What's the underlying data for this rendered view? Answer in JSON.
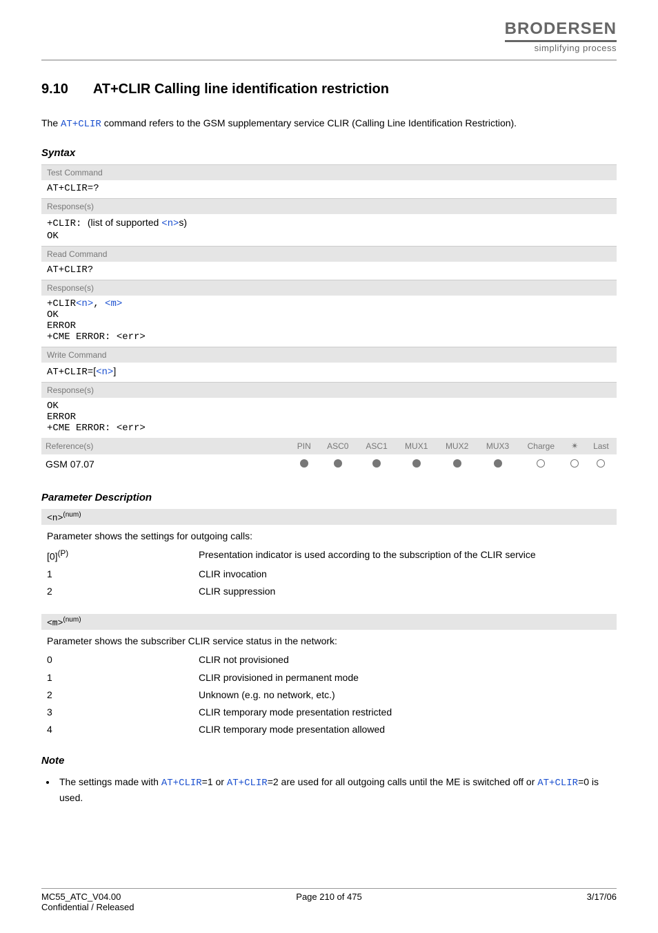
{
  "brand": {
    "name": "BRODERSEN",
    "tagline": "simplifying process"
  },
  "section": {
    "number": "9.10",
    "title": "AT+CLIR   Calling line identification restriction"
  },
  "intro": {
    "pre": "The ",
    "cmd": "AT+CLIR",
    "post": " command refers to the GSM supplementary service CLIR (Calling Line Identification Restriction)."
  },
  "labels": {
    "syntax": "Syntax",
    "test_command": "Test Command",
    "read_command": "Read Command",
    "write_command": "Write Command",
    "responses": "Response(s)",
    "references": "Reference(s)",
    "param_desc": "Parameter Description",
    "note": "Note"
  },
  "syntax": {
    "test_cmd": "AT+CLIR=?",
    "test_resp_prefix": "+CLIR: ",
    "test_resp_text": "(list of supported ",
    "test_resp_param": "<n>",
    "test_resp_suffix": "s)",
    "ok": "OK",
    "read_cmd": "AT+CLIR?",
    "read_resp_prefix": "+CLIR",
    "read_resp_n": "<n>",
    "read_resp_sep": ", ",
    "read_resp_m": "<m>",
    "error": "ERROR",
    "cme_error": "+CME ERROR: <err>",
    "write_cmd_prefix": "AT+CLIR=",
    "write_cmd_open": "[",
    "write_cmd_n": "<n>",
    "write_cmd_close": "]"
  },
  "ref": {
    "headers": [
      "PIN",
      "ASC0",
      "ASC1",
      "MUX1",
      "MUX2",
      "MUX3",
      "Charge",
      "✴",
      "Last"
    ],
    "name": "GSM 07.07",
    "values": [
      "filled",
      "filled",
      "filled",
      "filled",
      "filled",
      "filled",
      "empty",
      "empty",
      "empty"
    ]
  },
  "params": {
    "n": {
      "name": "<n>",
      "type": "(num)",
      "desc": "Parameter shows the settings for outgoing calls:",
      "rows": [
        {
          "key_html": "[0]<sup>(P)</sup>",
          "key": "[0]",
          "sup": "(P)",
          "val": "Presentation indicator is used according to the subscription of the CLIR service"
        },
        {
          "key": "1",
          "val": "CLIR invocation"
        },
        {
          "key": "2",
          "val": "CLIR suppression"
        }
      ]
    },
    "m": {
      "name": "<m>",
      "type": "(num)",
      "desc": "Parameter shows the subscriber CLIR service status in the network:",
      "rows": [
        {
          "key": "0",
          "val": "CLIR not provisioned"
        },
        {
          "key": "1",
          "val": "CLIR provisioned in permanent mode"
        },
        {
          "key": "2",
          "val": "Unknown (e.g. no network, etc.)"
        },
        {
          "key": "3",
          "val": "CLIR temporary mode presentation restricted"
        },
        {
          "key": "4",
          "val": "CLIR temporary mode presentation allowed"
        }
      ]
    }
  },
  "note": {
    "pre": "The settings made with ",
    "c1": "AT+CLIR",
    "mid1": "=1 or ",
    "c2": "AT+CLIR",
    "mid2": "=2 are used for all outgoing calls until the ME is switched off or ",
    "c3": "AT+CLIR",
    "post": "=0 is used."
  },
  "footer": {
    "doc": "MC55_ATC_V04.00",
    "conf": "Confidential / Released",
    "page": "Page 210 of 475",
    "date": "3/17/06"
  }
}
